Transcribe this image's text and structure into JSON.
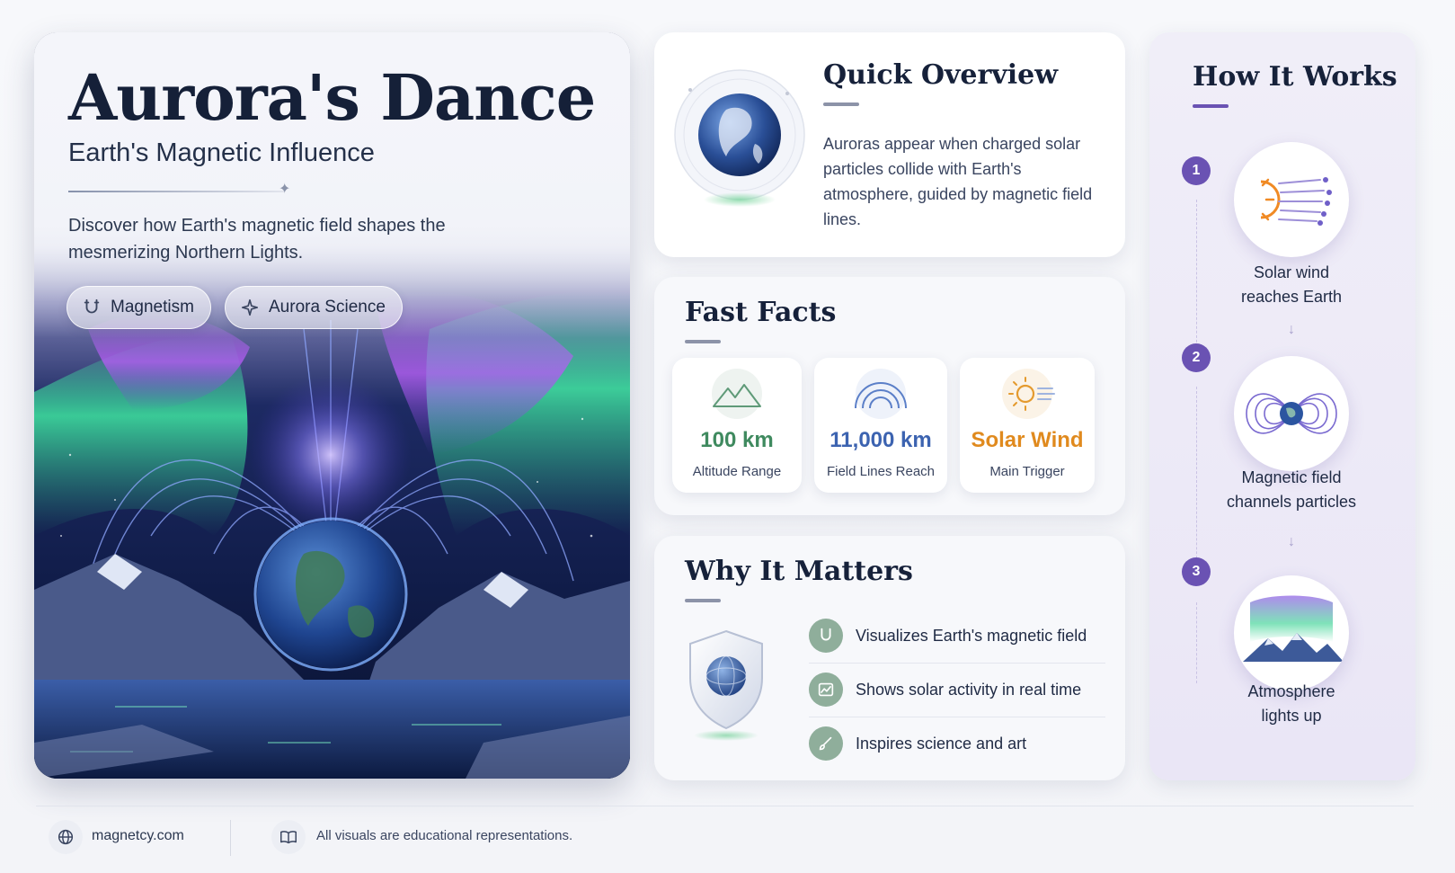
{
  "hero": {
    "title": "Aurora's Dance",
    "subtitle": "Earth's Magnetic Influence",
    "description": "Discover how Earth's magnetic field shapes the mesmerizing Northern Lights.",
    "chips": [
      {
        "label": "Magnetism",
        "icon": "magnet-icon"
      },
      {
        "label": "Aurora Science",
        "icon": "sparkle-icon"
      }
    ]
  },
  "overview": {
    "title": "Quick Overview",
    "text": "Auroras appear when charged solar particles collide with Earth's atmosphere, guided by magnetic field lines."
  },
  "facts": {
    "title": "Fast Facts",
    "items": [
      {
        "value": "100 km",
        "label": "Altitude Range",
        "icon": "mountain-icon",
        "color": "#3f8a5f"
      },
      {
        "value": "11,000 km",
        "label": "Field Lines Reach",
        "icon": "field-arc-icon",
        "color": "#3c63b0"
      },
      {
        "value": "Solar Wind",
        "label": "Main Trigger",
        "icon": "sun-icon",
        "color": "#e08a1e"
      }
    ]
  },
  "matters": {
    "title": "Why It Matters",
    "items": [
      {
        "text": "Visualizes Earth's magnetic field",
        "icon": "magnet-icon"
      },
      {
        "text": "Shows solar activity in real time",
        "icon": "chart-icon"
      },
      {
        "text": "Inspires science and art",
        "icon": "brush-icon"
      }
    ]
  },
  "how": {
    "title": "How It Works",
    "steps": [
      {
        "num": "1",
        "label_line1": "Solar wind",
        "label_line2": "reaches Earth",
        "icon": "solar-wind-icon"
      },
      {
        "num": "2",
        "label_line1": "Magnetic field",
        "label_line2": "channels particles",
        "icon": "magnetosphere-icon"
      },
      {
        "num": "3",
        "label_line1": "Atmosphere",
        "label_line2": "lights up",
        "icon": "aurora-mountain-icon"
      }
    ]
  },
  "footer": {
    "site": "magnetcy.com",
    "note": "All visuals are educational representations."
  },
  "colors": {
    "accent_purple": "#6a52b3",
    "green": "#3f8a5f",
    "blue": "#3c63b0",
    "orange": "#e08a1e"
  }
}
